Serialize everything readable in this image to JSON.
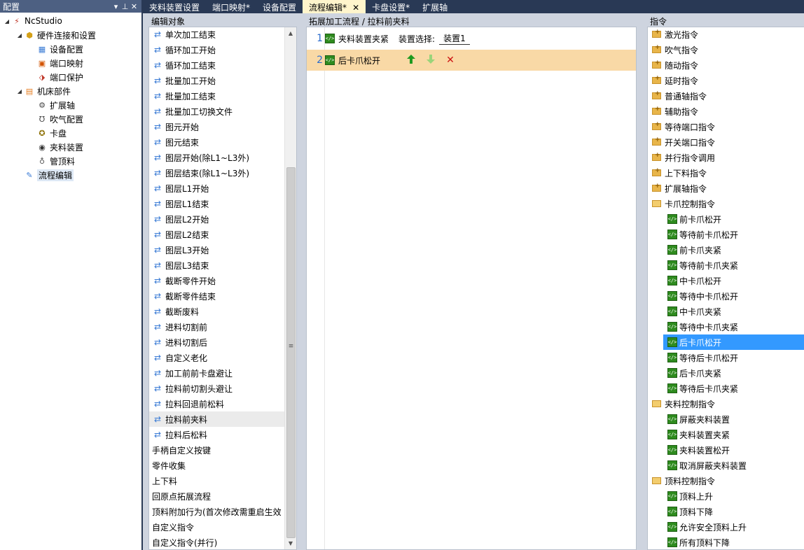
{
  "left_panel": {
    "title": "配置",
    "pin": "▾ ⊥",
    "close": "✕",
    "tree": [
      {
        "label": "NcStudio",
        "level": 0,
        "expander": "◢",
        "icon": "ncstudio-icon"
      },
      {
        "label": "硬件连接和设置",
        "level": 1,
        "expander": "◢",
        "icon": "hardware-icon"
      },
      {
        "label": "设备配置",
        "level": 2,
        "expander": "",
        "icon": "device-config-icon"
      },
      {
        "label": "端口映射",
        "level": 2,
        "expander": "",
        "icon": "port-map-icon"
      },
      {
        "label": "端口保护",
        "level": 2,
        "expander": "",
        "icon": "port-protect-icon"
      },
      {
        "label": "机床部件",
        "level": 1,
        "expander": "◢",
        "icon": "machine-parts-icon"
      },
      {
        "label": "扩展轴",
        "level": 2,
        "expander": "",
        "icon": "ext-axis-icon"
      },
      {
        "label": "吹气配置",
        "level": 2,
        "expander": "",
        "icon": "blow-icon"
      },
      {
        "label": "卡盘",
        "level": 2,
        "expander": "",
        "icon": "chuck-icon"
      },
      {
        "label": "夹料装置",
        "level": 2,
        "expander": "",
        "icon": "clamp-icon"
      },
      {
        "label": "管顶料",
        "level": 2,
        "expander": "",
        "icon": "pipe-push-icon"
      },
      {
        "label": "流程编辑",
        "level": 1,
        "expander": "",
        "icon": "flow-edit-icon",
        "selected": true
      }
    ]
  },
  "tabs": [
    {
      "label": "夹料装置设置",
      "active": false
    },
    {
      "label": "端口映射*",
      "active": false
    },
    {
      "label": "设备配置",
      "active": false
    },
    {
      "label": "流程编辑*",
      "active": true,
      "close": "✕"
    },
    {
      "label": "卡盘设置*",
      "active": false
    },
    {
      "label": "扩展轴",
      "active": false
    }
  ],
  "edit_objects": {
    "header": "编辑对象",
    "items": [
      {
        "label": "单次加工结束",
        "linked": true
      },
      {
        "label": "循环加工开始",
        "linked": true
      },
      {
        "label": "循环加工结束",
        "linked": true
      },
      {
        "label": "批量加工开始",
        "linked": true
      },
      {
        "label": "批量加工结束",
        "linked": true
      },
      {
        "label": "批量加工切换文件",
        "linked": true
      },
      {
        "label": "图元开始",
        "linked": true
      },
      {
        "label": "图元结束",
        "linked": true
      },
      {
        "label": "图层开始(除L1~L3外)",
        "linked": true
      },
      {
        "label": "图层结束(除L1~L3外)",
        "linked": true
      },
      {
        "label": "图层L1开始",
        "linked": true
      },
      {
        "label": "图层L1结束",
        "linked": true
      },
      {
        "label": "图层L2开始",
        "linked": true
      },
      {
        "label": "图层L2结束",
        "linked": true
      },
      {
        "label": "图层L3开始",
        "linked": true
      },
      {
        "label": "图层L3结束",
        "linked": true
      },
      {
        "label": "截断零件开始",
        "linked": true
      },
      {
        "label": "截断零件结束",
        "linked": true
      },
      {
        "label": "截断废料",
        "linked": true
      },
      {
        "label": "进料切割前",
        "linked": true
      },
      {
        "label": "进料切割后",
        "linked": true
      },
      {
        "label": "自定义老化",
        "linked": true
      },
      {
        "label": "加工前前卡盘避让",
        "linked": true
      },
      {
        "label": "拉料前切割头避让",
        "linked": true
      },
      {
        "label": "拉料回退前松料",
        "linked": true
      },
      {
        "label": "拉料前夹料",
        "linked": true,
        "selected": true
      },
      {
        "label": "拉料后松料",
        "linked": true
      },
      {
        "label": "手柄自定义按键",
        "linked": false
      },
      {
        "label": "零件收集",
        "linked": false
      },
      {
        "label": "上下料",
        "linked": false
      },
      {
        "label": "回原点拓展流程",
        "linked": false
      },
      {
        "label": "顶料附加行为(首次修改需重启生效",
        "linked": false
      },
      {
        "label": "自定义指令",
        "linked": false
      },
      {
        "label": "自定义指令(并行)",
        "linked": false
      }
    ],
    "scroll_up": "▲",
    "scroll_down": "▼",
    "scroll_grip": "≡"
  },
  "flow": {
    "header": "拓展加工流程 / 拉料前夹料",
    "rows": [
      {
        "num": "1",
        "label": "夹料装置夹紧",
        "device_label": "装置选择:",
        "device_value": "装置1",
        "selected": false
      },
      {
        "num": "2",
        "label": "后卡爪松开",
        "selected": true,
        "up": "🡅",
        "down": "🡇",
        "del": "✕"
      }
    ]
  },
  "instructions": {
    "header": "指令",
    "items": [
      {
        "label": "激光指令",
        "type": "folder"
      },
      {
        "label": "吹气指令",
        "type": "folder"
      },
      {
        "label": "随动指令",
        "type": "folder"
      },
      {
        "label": "延时指令",
        "type": "folder"
      },
      {
        "label": "普通轴指令",
        "type": "folder"
      },
      {
        "label": "辅助指令",
        "type": "folder"
      },
      {
        "label": "等待端口指令",
        "type": "folder"
      },
      {
        "label": "开关端口指令",
        "type": "folder"
      },
      {
        "label": "并行指令调用",
        "type": "folder"
      },
      {
        "label": "上下料指令",
        "type": "folder"
      },
      {
        "label": "扩展轴指令",
        "type": "folder"
      },
      {
        "label": "卡爪控制指令",
        "type": "folder-open"
      },
      {
        "label": "前卡爪松开",
        "type": "item"
      },
      {
        "label": "等待前卡爪松开",
        "type": "item"
      },
      {
        "label": "前卡爪夹紧",
        "type": "item"
      },
      {
        "label": "等待前卡爪夹紧",
        "type": "item"
      },
      {
        "label": "中卡爪松开",
        "type": "item"
      },
      {
        "label": "等待中卡爪松开",
        "type": "item"
      },
      {
        "label": "中卡爪夹紧",
        "type": "item"
      },
      {
        "label": "等待中卡爪夹紧",
        "type": "item"
      },
      {
        "label": "后卡爪松开",
        "type": "item",
        "selected": true
      },
      {
        "label": "等待后卡爪松开",
        "type": "item"
      },
      {
        "label": "后卡爪夹紧",
        "type": "item"
      },
      {
        "label": "等待后卡爪夹紧",
        "type": "item"
      },
      {
        "label": "夹料控制指令",
        "type": "folder-open"
      },
      {
        "label": "屏蔽夹料装置",
        "type": "item"
      },
      {
        "label": "夹料装置夹紧",
        "type": "item"
      },
      {
        "label": "夹料装置松开",
        "type": "item"
      },
      {
        "label": "取消屏蔽夹料装置",
        "type": "item"
      },
      {
        "label": "顶料控制指令",
        "type": "folder-open"
      },
      {
        "label": "顶料上升",
        "type": "item"
      },
      {
        "label": "顶料下降",
        "type": "item"
      },
      {
        "label": "允许安全顶料上升",
        "type": "item"
      },
      {
        "label": "所有顶料下降",
        "type": "item"
      }
    ]
  },
  "colors": {
    "titlebar": "#293955",
    "active_tab": "#fff5cc",
    "selected_row": "#f9d9a6",
    "selected_instruction": "#3399ff",
    "arrow_up": "#1f9a1f",
    "arrow_down": "#9ad47a",
    "delete": "#cc1111"
  }
}
